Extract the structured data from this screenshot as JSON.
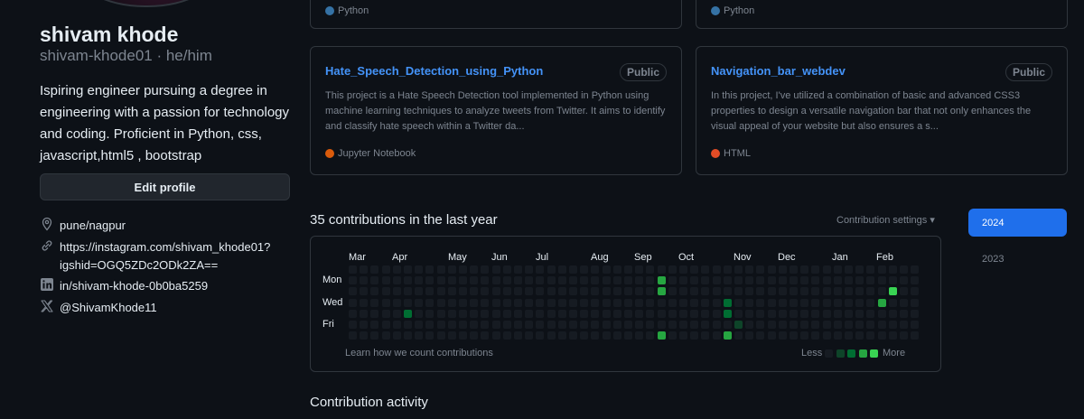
{
  "profile": {
    "name": "shivam khode",
    "handle": "shivam-khode01 · he/him",
    "bio": "Ispiring engineer pursuing a degree in engineering with a passion for technology and coding. Proficient in Python, css, javascript,html5 , bootstrap",
    "edit_label": "Edit profile",
    "location": "pune/nagpur",
    "instagram_line1": "https://instagram.com/shivam_khode01?",
    "instagram_line2": "igshid=OGQ5ZDc2ODk2ZA==",
    "linkedin": "in/shivam-khode-0b0ba5259",
    "twitter": "@ShivamKhode11"
  },
  "repos_top": [
    {
      "lang": "Python",
      "lang_color": "#3572A5"
    },
    {
      "lang": "Python",
      "lang_color": "#3572A5"
    }
  ],
  "repos": [
    {
      "name": "Hate_Speech_Detection_using_Python",
      "visibility": "Public",
      "description": "This project is a Hate Speech Detection tool implemented in Python using machine learning techniques to analyze tweets from Twitter. It aims to identify and classify hate speech within a Twitter da...",
      "lang": "Jupyter Notebook",
      "lang_color": "#DA5B0B"
    },
    {
      "name": "Navigation_bar_webdev",
      "visibility": "Public",
      "description": "In this project, I've utilized a combination of basic and advanced CSS3 properties to design a versatile navigation bar that not only enhances the visual appeal of your website but also ensures a s...",
      "lang": "HTML",
      "lang_color": "#e34c26"
    }
  ],
  "contributions": {
    "title": "35 contributions in the last year",
    "settings_label": "Contribution settings ▾",
    "months": [
      "Mar",
      "Apr",
      "May",
      "Jun",
      "Jul",
      "Aug",
      "Sep",
      "Oct",
      "Nov",
      "Dec",
      "Jan",
      "Feb"
    ],
    "days": [
      "Mon",
      "Wed",
      "Fri"
    ],
    "learn_label": "Learn how we count contributions",
    "less_label": "Less",
    "more_label": "More",
    "level_colors": [
      "#161b22",
      "#0e4429",
      "#006d32",
      "#26a641",
      "#39d353"
    ],
    "active_cells": [
      {
        "week": 5,
        "day": 4,
        "level": 2
      },
      {
        "week": 28,
        "day": 1,
        "level": 3
      },
      {
        "week": 28,
        "day": 2,
        "level": 3
      },
      {
        "week": 28,
        "day": 6,
        "level": 3
      },
      {
        "week": 34,
        "day": 3,
        "level": 2
      },
      {
        "week": 34,
        "day": 4,
        "level": 2
      },
      {
        "week": 34,
        "day": 6,
        "level": 3
      },
      {
        "week": 35,
        "day": 5,
        "level": 1
      },
      {
        "week": 48,
        "day": 3,
        "level": 3
      },
      {
        "week": 49,
        "day": 2,
        "level": 4
      }
    ]
  },
  "years": [
    "2024",
    "2023"
  ],
  "activity_title": "Contribution activity"
}
